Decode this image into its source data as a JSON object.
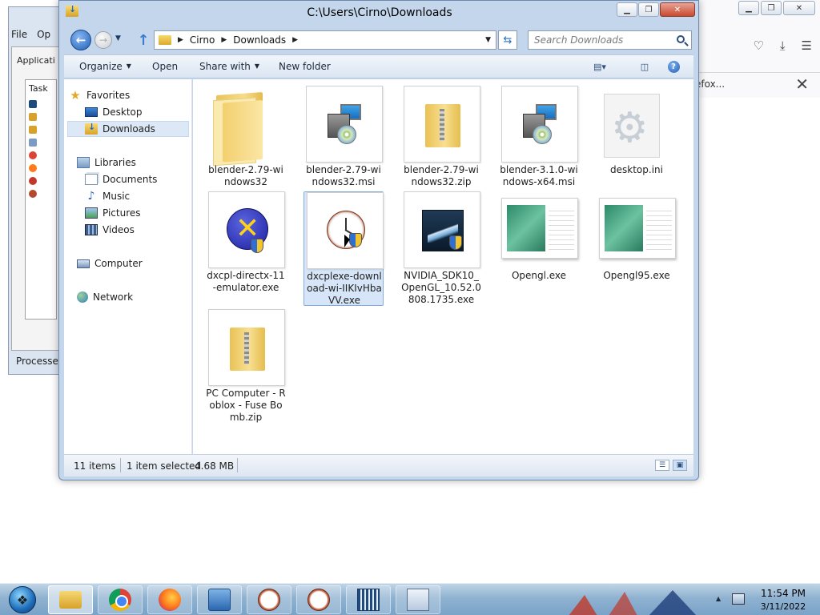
{
  "firefox_bg": {
    "tab_text": "efox..."
  },
  "taskmgr_bg": {
    "menu": [
      "File",
      "Op"
    ],
    "tab": "Applicati",
    "list_header": "Task",
    "status": "Processes"
  },
  "explorer": {
    "title": "C:\\Users\\Cirno\\Downloads",
    "breadcrumb": [
      "Cirno",
      "Downloads"
    ],
    "search_placeholder": "Search Downloads",
    "toolbar": {
      "organize": "Organize",
      "open": "Open",
      "share_with": "Share with",
      "new_folder": "New folder"
    },
    "nav": {
      "favorites": "Favorites",
      "desktop": "Desktop",
      "downloads": "Downloads",
      "libraries": "Libraries",
      "documents": "Documents",
      "music": "Music",
      "pictures": "Pictures",
      "videos": "Videos",
      "computer": "Computer",
      "network": "Network"
    },
    "files": [
      {
        "name": "blender-2.79-windows32",
        "type": "folder"
      },
      {
        "name": "blender-2.79-windows32.msi",
        "type": "msi"
      },
      {
        "name": "blender-2.79-windows32.zip",
        "type": "zip"
      },
      {
        "name": "blender-3.1.0-windows-x64.msi",
        "type": "msi"
      },
      {
        "name": "desktop.ini",
        "type": "ini"
      },
      {
        "name": "dxcpl-directx-11-emulator.exe",
        "type": "exe-dx"
      },
      {
        "name": "dxcplexe-download-wi-IIKIvHbaVV.exe",
        "type": "exe-clock",
        "selected": true
      },
      {
        "name": "NVIDIA_SDK10_OpenGL_10.52.0808.1735.exe",
        "type": "exe-nvidia"
      },
      {
        "name": "Opengl.exe",
        "type": "exe-window"
      },
      {
        "name": "Opengl95.exe",
        "type": "exe-window"
      },
      {
        "name": "PC Computer - Roblox - Fuse Bomb.zip",
        "type": "zip"
      }
    ],
    "status": {
      "item_count": "11 items",
      "selection": "1 item selected",
      "size": "4.68 MB"
    }
  },
  "taskbar": {
    "time": "11:54 PM",
    "date": "3/11/2022",
    "pinned": [
      "explorer-icon",
      "chrome-icon",
      "firefox-icon",
      "control-panel-icon",
      "clock-app-icon",
      "clock-app-icon",
      "cpu-z-icon",
      "performance-icon"
    ]
  },
  "colors": {
    "selection_bg": "#d6e6f8",
    "selection_border": "#84acdd",
    "window_frame": "#c4d6ec",
    "taskbar": "#8fb2d1"
  }
}
